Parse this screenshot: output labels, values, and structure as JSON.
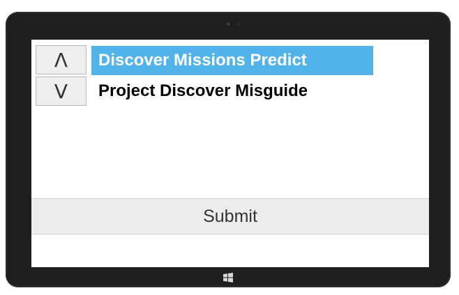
{
  "controls": {
    "up_glyph": "Λ",
    "down_glyph": "V"
  },
  "options": [
    {
      "label": "Discover Missions Predict",
      "selected": true
    },
    {
      "label": "Project Discover Misguide",
      "selected": false
    }
  ],
  "submit_label": "Submit",
  "colors": {
    "selection": "#51b3ea",
    "bezel": "#1e1e1e",
    "button": "#eeeeee"
  },
  "icons": {
    "home": "windows-logo-icon"
  }
}
